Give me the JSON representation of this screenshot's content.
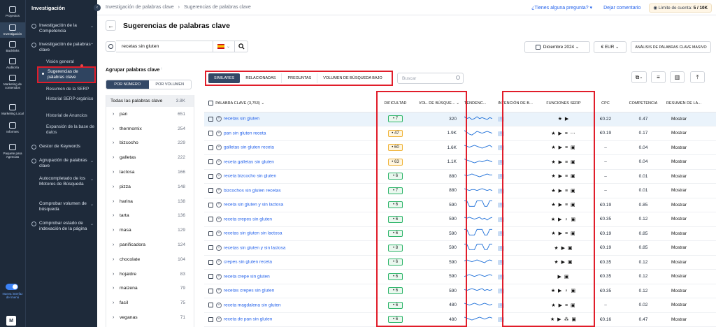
{
  "rail": {
    "items": [
      {
        "label": "Proyectos",
        "icon": "home-icon"
      },
      {
        "label": "Investigación",
        "icon": "research-icon"
      },
      {
        "label": "Backlinks",
        "icon": "link-icon"
      },
      {
        "label": "Auditoría",
        "icon": "audit-icon"
      },
      {
        "label": "Marketing de contenidos",
        "icon": "edit-icon"
      },
      {
        "label": "Marketing Local",
        "icon": "pin-icon"
      },
      {
        "label": "Informes",
        "icon": "report-icon"
      },
      {
        "label": "Paquete para Agencias",
        "icon": "package-icon"
      }
    ],
    "new_ui": "Nueva interfaz del menú",
    "avatar": "M"
  },
  "nav": {
    "title": "Investigación",
    "items": [
      "Investigación de la Competencia",
      "Investigación de palabras clave",
      "Gestor de Keywords",
      "Agrupación de palabras clave",
      "Autocompletado de los Motores de Búsqueda",
      "Comprobar volumen de búsqueda",
      "Comprobar estado de indexación de la página"
    ],
    "subitems": [
      "Visión general",
      "Sugerencias de palabras clave",
      "Resumen de la SERP",
      "Historial SERP orgánico",
      "Historial de Anuncios",
      "Expansión de la base de datos"
    ]
  },
  "topbar": {
    "breadcrumb": [
      "Investigación de palabras clave",
      "Sugerencias de palabras clave"
    ],
    "help": "¿Tienes alguna pregunta?",
    "feedback": "Dejar comentario",
    "limit_label": "Límite de cuenta:",
    "limit_value": "5 / 10K"
  },
  "page": {
    "title": "Sugerencias de palabras clave"
  },
  "search": {
    "value": "recetas sin gluten",
    "date": "Diciembre 2024",
    "currency": "€ EUR",
    "bulk": "ANÁLISIS DE PALABRAS CLAVE MASIVO"
  },
  "groups": {
    "title": "Agrupar palabras clave",
    "by_number": "POR NÚMERO",
    "by_volume": "POR VOLUMEN",
    "all_label": "Todas las palabras clave",
    "all_count": "3.8K",
    "items": [
      {
        "name": "pan",
        "count": "651"
      },
      {
        "name": "thermomix",
        "count": "254"
      },
      {
        "name": "bizcocho",
        "count": "229"
      },
      {
        "name": "galletas",
        "count": "222"
      },
      {
        "name": "lactosa",
        "count": "166"
      },
      {
        "name": "pizza",
        "count": "148"
      },
      {
        "name": "harina",
        "count": "138"
      },
      {
        "name": "tarta",
        "count": "136"
      },
      {
        "name": "masa",
        "count": "129"
      },
      {
        "name": "panificadora",
        "count": "124"
      },
      {
        "name": "chocolate",
        "count": "104"
      },
      {
        "name": "hojaldre",
        "count": "83"
      },
      {
        "name": "maizena",
        "count": "79"
      },
      {
        "name": "facil",
        "count": "75"
      },
      {
        "name": "veganas",
        "count": "71"
      },
      {
        "name": "crepes",
        "count": "69"
      }
    ]
  },
  "filters": {
    "tabs": [
      "SIMILARES",
      "RELACIONADAS",
      "PREGUNTAS",
      "VOLUMEN DE BÚSQUEDA BAJO"
    ],
    "search_placeholder": "Buscar"
  },
  "table": {
    "headers": [
      "PALABRA CLAVE (3,753)",
      "DIFICULTAD",
      "VOL. DE BÚSQUE...",
      "TENDENC...",
      "INTENCIÓN DE B...",
      "FUNCIONES SERP",
      "CPC",
      "COMPETENCIA",
      "RESUMEN DE LA..."
    ],
    "rows": [
      {
        "kw": "recetas sin gluten",
        "diff": "7",
        "diff_color": "green",
        "vol": "320",
        "intent": "I",
        "serp": "★ ▶",
        "cpc": "€0.22",
        "comp": "0.47",
        "action": "Mostrar",
        "trend": [
          6,
          4,
          5,
          3,
          4,
          6,
          4,
          5,
          4,
          3,
          5,
          4
        ],
        "hl": true
      },
      {
        "kw": "pan sin gluten receta",
        "diff": "47",
        "diff_color": "yellow",
        "vol": "1.9K",
        "intent": "I",
        "serp": "★ ▶ ≡ ⋯",
        "cpc": "€0.19",
        "comp": "0.17",
        "action": "Mostrar",
        "trend": [
          7,
          5,
          3,
          2,
          4,
          6,
          5,
          4,
          5,
          6,
          5,
          4
        ],
        "hl": false
      },
      {
        "kw": "galletas sin gluten receta",
        "diff": "60",
        "diff_color": "yellow",
        "vol": "1.6K",
        "intent": "I",
        "serp": "★ ▶ ≡ ▣",
        "cpc": "–",
        "comp": "0.04",
        "action": "Mostrar",
        "trend": [
          6,
          5,
          4,
          5,
          6,
          5,
          4,
          3,
          4,
          5,
          6,
          4
        ],
        "hl": false
      },
      {
        "kw": "receta galletas sin gluten",
        "diff": "63",
        "diff_color": "yellow",
        "vol": "1.1K",
        "intent": "I",
        "serp": "★ ▶ ≡ ▣",
        "cpc": "–",
        "comp": "0.04",
        "action": "Mostrar",
        "trend": [
          7,
          6,
          5,
          4,
          3,
          4,
          5,
          4,
          5,
          6,
          5,
          4
        ],
        "hl": false
      },
      {
        "kw": "receta bizcocho sin gluten",
        "diff": "6",
        "diff_color": "green",
        "vol": "880",
        "intent": "I",
        "serp": "★ ▶ ≡ ▣",
        "cpc": "–",
        "comp": "0.01",
        "action": "Mostrar",
        "trend": [
          5,
          4,
          5,
          6,
          5,
          4,
          3,
          4,
          5,
          6,
          5,
          5
        ],
        "hl": false
      },
      {
        "kw": "bizcochos sin gluten recetas",
        "diff": "7",
        "diff_color": "green",
        "vol": "880",
        "intent": "I",
        "serp": "★ ▶ ≡ ▣",
        "cpc": "–",
        "comp": "0.01",
        "action": "Mostrar",
        "trend": [
          6,
          5,
          4,
          5,
          5,
          4,
          5,
          6,
          5,
          4,
          5,
          4
        ],
        "hl": false
      },
      {
        "kw": "receta sin gluten y sin lactosa",
        "diff": "6",
        "diff_color": "green",
        "vol": "590",
        "intent": "I",
        "serp": "★ ▶ ≡ ▣",
        "cpc": "€0.19",
        "comp": "0.85",
        "action": "Mostrar",
        "trend": [
          8,
          8,
          2,
          2,
          2,
          8,
          8,
          8,
          2,
          2,
          8,
          8
        ],
        "hl": false
      },
      {
        "kw": "receta crepes sin gluten",
        "diff": "6",
        "diff_color": "green",
        "vol": "590",
        "intent": "I",
        "serp": "★ ▶ ♀ ▣",
        "cpc": "€0.35",
        "comp": "0.12",
        "action": "Mostrar",
        "trend": [
          6,
          5,
          6,
          5,
          4,
          5,
          6,
          4,
          5,
          3,
          5,
          6
        ],
        "hl": false
      },
      {
        "kw": "recetas sin gluten sin lactosa",
        "diff": "6",
        "diff_color": "green",
        "vol": "590",
        "intent": "I",
        "serp": "★ ▶ ≡ ▣",
        "cpc": "€0.19",
        "comp": "0.85",
        "action": "Mostrar",
        "trend": [
          8,
          8,
          2,
          2,
          2,
          8,
          8,
          8,
          2,
          2,
          8,
          8
        ],
        "hl": false
      },
      {
        "kw": "recetas sin gluten y sin lactosa",
        "diff": "8",
        "diff_color": "green",
        "vol": "590",
        "intent": "I",
        "serp": "★ ▶ ▣",
        "cpc": "€0.19",
        "comp": "0.85",
        "action": "Mostrar",
        "trend": [
          8,
          8,
          2,
          2,
          2,
          8,
          8,
          8,
          2,
          2,
          8,
          8
        ],
        "hl": false
      },
      {
        "kw": "crepes sin gluten receta",
        "diff": "6",
        "diff_color": "green",
        "vol": "590",
        "intent": "I",
        "serp": "★ ▶ ▣",
        "cpc": "€0.35",
        "comp": "0.12",
        "action": "Mostrar",
        "trend": [
          5,
          6,
          5,
          4,
          5,
          6,
          5,
          4,
          3,
          5,
          6,
          5
        ],
        "hl": false
      },
      {
        "kw": "receta crepe sin gluten",
        "diff": "6",
        "diff_color": "green",
        "vol": "590",
        "intent": "I",
        "serp": "▶ ▣",
        "cpc": "€0.35",
        "comp": "0.12",
        "action": "Mostrar",
        "trend": [
          4,
          5,
          6,
          5,
          4,
          5,
          6,
          5,
          4,
          5,
          6,
          5
        ],
        "hl": false
      },
      {
        "kw": "recetas crepes sin gluten",
        "diff": "6",
        "diff_color": "green",
        "vol": "590",
        "intent": "I",
        "serp": "★ ▶ ♀ ▣",
        "cpc": "€0.35",
        "comp": "0.12",
        "action": "Mostrar",
        "trend": [
          5,
          4,
          5,
          6,
          5,
          4,
          5,
          6,
          4,
          5,
          4,
          5
        ],
        "hl": false
      },
      {
        "kw": "receta magdalena sin gluten",
        "diff": "6",
        "diff_color": "green",
        "vol": "480",
        "intent": "I",
        "serp": "★ ▶ ≡ ▣",
        "cpc": "–",
        "comp": "0.02",
        "action": "Mostrar",
        "trend": [
          6,
          5,
          4,
          5,
          6,
          5,
          4,
          5,
          6,
          5,
          4,
          5
        ],
        "hl": false
      },
      {
        "kw": "receta de pan sin gluten",
        "diff": "6",
        "diff_color": "green",
        "vol": "480",
        "intent": "I",
        "serp": "★ ▶ ⁂ ▣",
        "cpc": "€0.16",
        "comp": "0.47",
        "action": "Mostrar",
        "trend": [
          6,
          5,
          4,
          3,
          4,
          5,
          6,
          5,
          4,
          5,
          6,
          5
        ],
        "hl": false
      }
    ]
  },
  "colors": {
    "accent": "#334866",
    "highlight": "#e11d2a",
    "link": "#2563eb"
  }
}
